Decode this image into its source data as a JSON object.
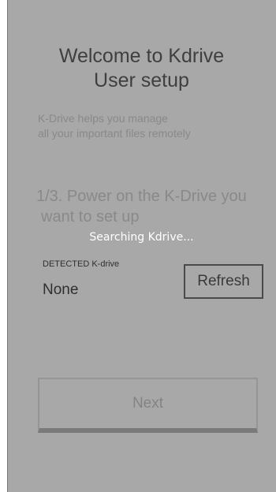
{
  "header": {
    "title_line1": "Welcome to Kdrive",
    "title_line2": "User setup"
  },
  "intro": {
    "line1": "K-Drive helps you manage",
    "line2": "all your important files remotely"
  },
  "step": {
    "line1": "1/3. Power on the K-Drive you",
    "line2": "want to set up"
  },
  "status": {
    "searching": "Searching Kdrive..."
  },
  "detected": {
    "label": "DETECTED K-drive",
    "value": "None"
  },
  "buttons": {
    "refresh": "Refresh",
    "next": "Next"
  },
  "colors": {
    "overlay": "#a8a8a8",
    "title_text": "#3f3f3f",
    "muted_text": "#898989",
    "status_text": "#ffffff"
  }
}
